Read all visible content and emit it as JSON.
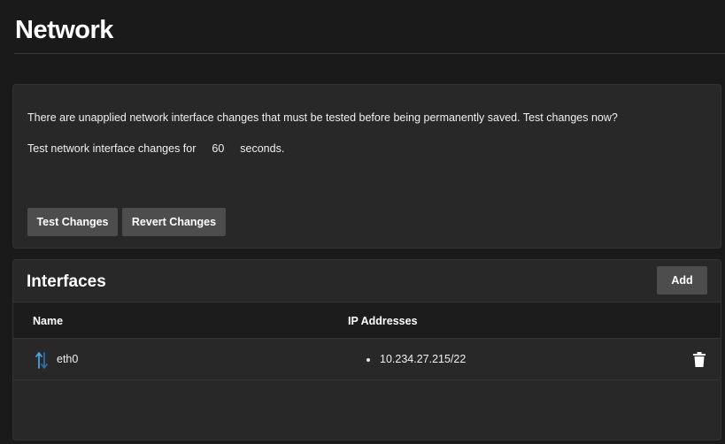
{
  "page": {
    "title": "Network"
  },
  "pending": {
    "message": "There are unapplied network interface changes that must be tested before being permanently saved. Test changes now?",
    "timer_prefix": "Test network interface changes for",
    "timer_value": "60",
    "timer_suffix": "seconds.",
    "test_label": "Test Changes",
    "revert_label": "Revert Changes"
  },
  "interfaces": {
    "title": "Interfaces",
    "add_label": "Add",
    "columns": [
      "Name",
      "IP Addresses"
    ],
    "rows": [
      {
        "name": "eth0",
        "ip": "10.234.27.215/22",
        "icon": "up-down-arrows-icon"
      }
    ]
  },
  "colors": {
    "background": "#1a1a1a",
    "card": "#282828",
    "button": "#4d4d4d",
    "arrow_up": "#4aa3df",
    "arrow_down": "#2a6fa8"
  }
}
